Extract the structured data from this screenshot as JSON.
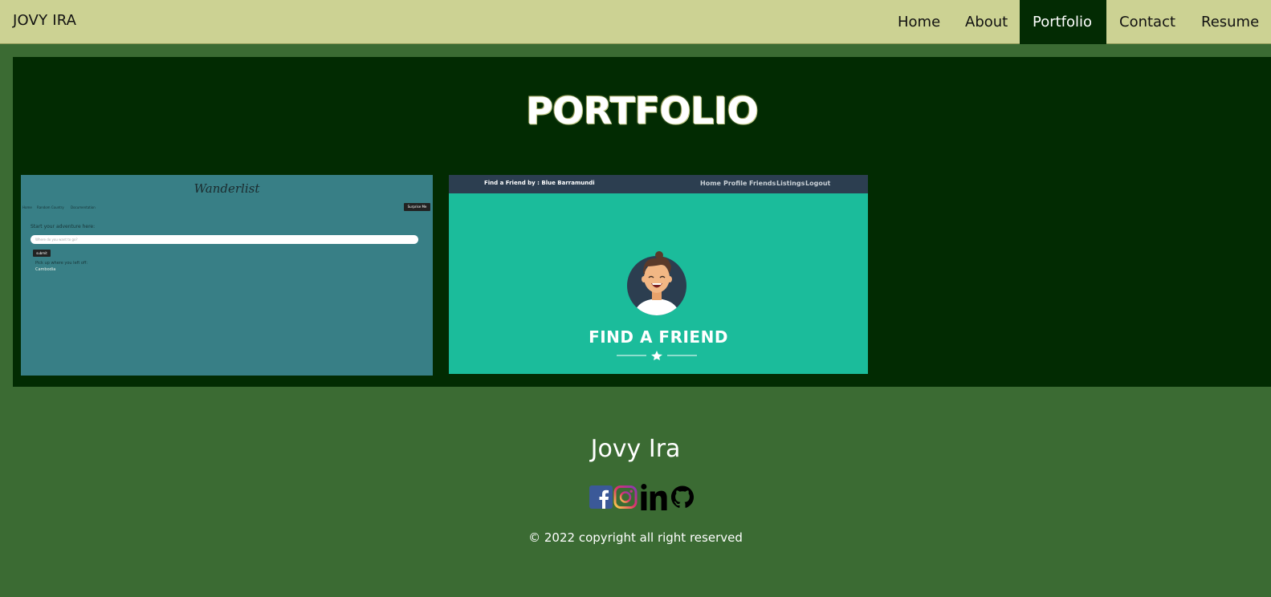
{
  "navbar": {
    "brand": "JOVY IRA",
    "items": [
      {
        "label": "Home",
        "active": false
      },
      {
        "label": "About",
        "active": false
      },
      {
        "label": "Portfolio",
        "active": true
      },
      {
        "label": "Contact",
        "active": false
      },
      {
        "label": "Resume",
        "active": false
      }
    ]
  },
  "portfolio": {
    "title": "PORTFOLIO",
    "projects": [
      {
        "name": "Wanderlist",
        "nav_links": [
          "Home",
          "Random Country",
          "Documentation"
        ],
        "surprise_button": "Surprise Me",
        "start_prompt": "Start your adventure here:",
        "input_placeholder": "Where do you want to go?",
        "submit_label": "submit",
        "pickup_text": "Pick up where you left off:",
        "saved_country": "Cambodia"
      },
      {
        "name": "Find a Friend",
        "brand": "Find a Friend by : Blue Barramundi",
        "nav_links": [
          "Home",
          "Profile",
          "Friends",
          "Listings",
          "Logout"
        ],
        "heading": "FIND A FRIEND"
      }
    ]
  },
  "footer": {
    "name": "Jovy Ira",
    "social_icons": [
      "facebook-icon",
      "instagram-icon",
      "linkedin-icon",
      "github-icon"
    ],
    "copyright": "© 2022 copyright all right reserved"
  },
  "colors": {
    "navbar_bg": "#ccd293",
    "nav_active_bg": "#032b03",
    "page_bg": "#3b6b33",
    "portfolio_bg": "#022b02",
    "wanderlist_bg": "#387f86",
    "find_friend_bg": "#1bbc9b"
  }
}
